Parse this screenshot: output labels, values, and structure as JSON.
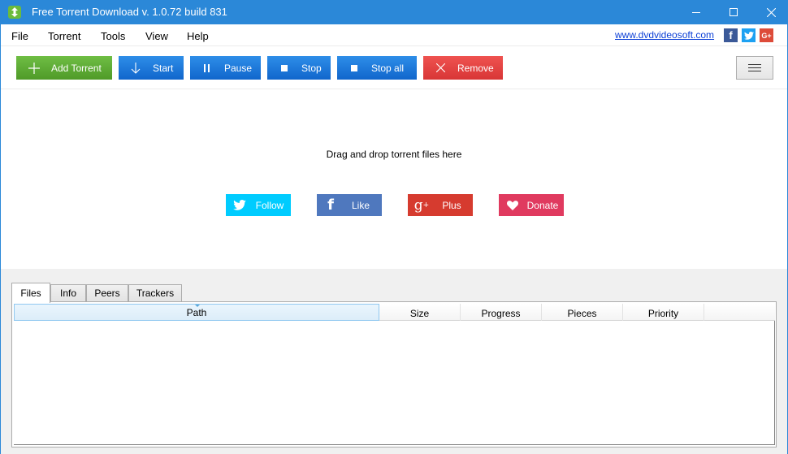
{
  "window": {
    "title": "Free Torrent Download v. 1.0.72 build 831",
    "controls": {
      "minimize": "minimize",
      "maximize": "maximize",
      "close": "close"
    }
  },
  "menu": {
    "items": [
      {
        "label": "File"
      },
      {
        "label": "Torrent"
      },
      {
        "label": "Tools"
      },
      {
        "label": "View"
      },
      {
        "label": "Help"
      }
    ],
    "site_link": "www.dvdvideosoft.com",
    "social_icons": [
      "facebook-icon",
      "twitter-icon",
      "google-plus-icon"
    ]
  },
  "toolbar": {
    "add_torrent": "Add Torrent",
    "start": "Start",
    "pause": "Pause",
    "stop": "Stop",
    "stop_all": "Stop all",
    "remove": "Remove",
    "colors": {
      "green": "#5aab33",
      "blue": "#1a78dc",
      "red": "#e04444"
    }
  },
  "drop_area": {
    "text": "Drag and drop torrent files here",
    "buttons": {
      "follow": "Follow",
      "like": "Like",
      "plus": "Plus",
      "donate": "Donate"
    },
    "colors": {
      "follow": "#00ccff",
      "like": "#4f78be",
      "plus": "#d63b2f",
      "donate": "#e03a5f"
    }
  },
  "details": {
    "tabs": [
      {
        "label": "Files",
        "active": true
      },
      {
        "label": "Info",
        "active": false
      },
      {
        "label": "Peers",
        "active": false
      },
      {
        "label": "Trackers",
        "active": false
      }
    ],
    "columns": [
      "Path",
      "Size",
      "Progress",
      "Pieces",
      "Priority"
    ],
    "rows": []
  }
}
